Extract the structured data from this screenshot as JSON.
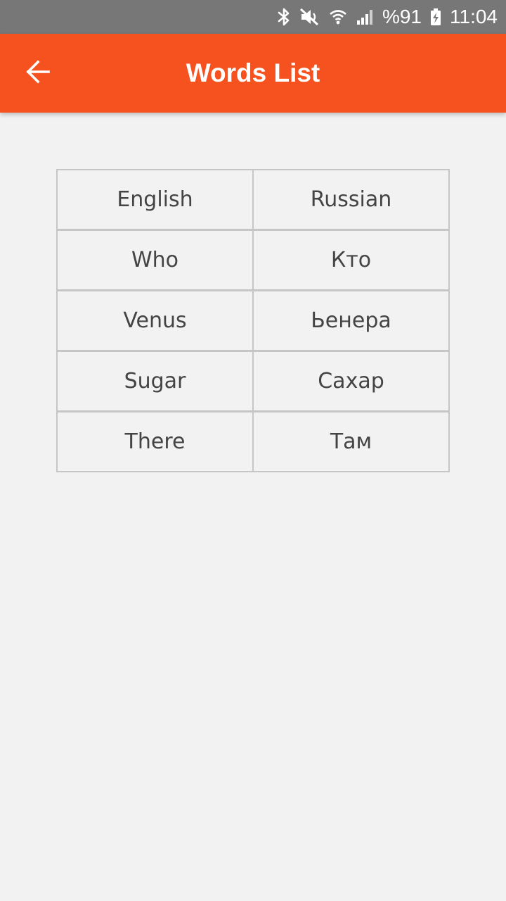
{
  "status_bar": {
    "battery": "%91",
    "time": "11:04",
    "icons": [
      "bluetooth-icon",
      "mute-icon",
      "wifi-icon",
      "cell-signal-icon",
      "battery-charging-icon"
    ]
  },
  "app_bar": {
    "title": "Words List",
    "back_icon": "back-arrow-icon",
    "color": "#f5521f"
  },
  "table": {
    "headers": [
      "English",
      "Russian"
    ],
    "rows": [
      [
        "Who",
        "Кто"
      ],
      [
        "Venus",
        "Ьенера"
      ],
      [
        "Sugar",
        "Сахар"
      ],
      [
        "There",
        "Там"
      ]
    ]
  }
}
